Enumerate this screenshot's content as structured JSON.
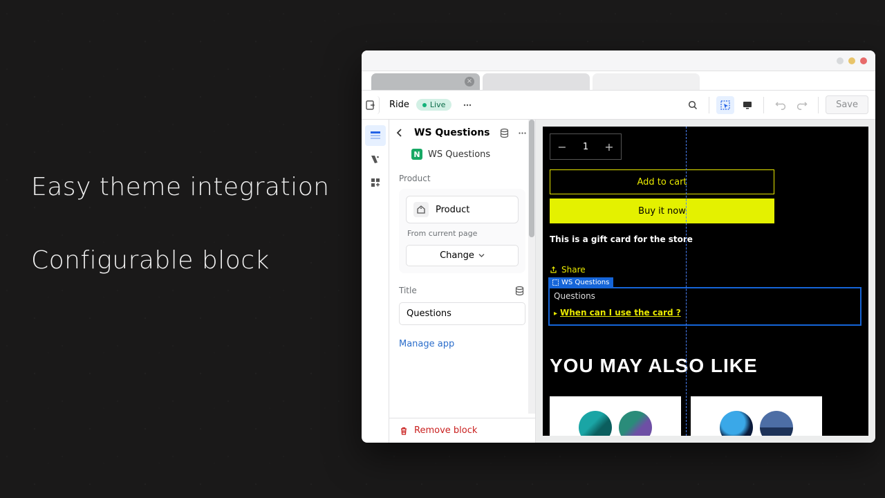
{
  "callouts": {
    "line1": "Easy theme integration",
    "line2": "Configurable block"
  },
  "toolbar": {
    "theme_name": "Ride",
    "status": "Live",
    "save": "Save"
  },
  "sidebar": {
    "title": "WS Questions",
    "app_name": "WS Questions",
    "product_section": {
      "label": "Product",
      "product_label": "Product",
      "note": "From current page",
      "change": "Change"
    },
    "title_section": {
      "label": "Title",
      "value": "Questions"
    },
    "manage_link": "Manage app",
    "remove": "Remove block"
  },
  "preview": {
    "quantity": "1",
    "add_to_cart": "Add to cart",
    "buy_now": "Buy it now",
    "gift_text": "This is a gift card for the store",
    "share": "Share",
    "block_label": "WS Questions",
    "q_title": "Questions",
    "q_item": "When can I use the card ?",
    "ymal": "YOU MAY ALSO LIKE"
  }
}
